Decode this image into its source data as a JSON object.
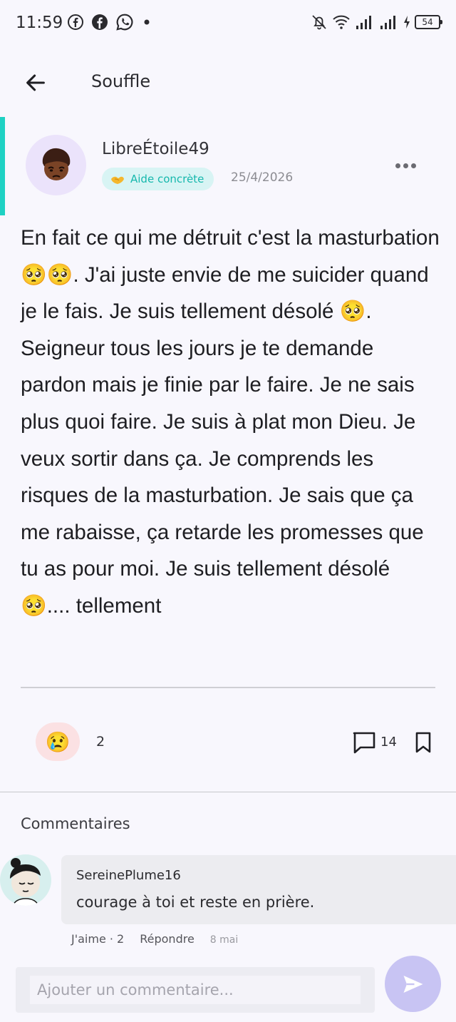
{
  "status_bar": {
    "time": "11:59",
    "battery": "54"
  },
  "app_bar": {
    "title": "Souffle"
  },
  "post": {
    "author": "LibreÉtoile49",
    "tag_label": "Aide concrète",
    "date": "25/4/2026",
    "body": "En fait ce qui me détruit c'est la masturbation 🥺🥺. J'ai juste envie de me suicider quand je le fais.  Je suis tellement désolé 🥺. Seigneur tous les jours je te demande pardon mais je finie par le faire.  Je ne sais plus quoi faire. Je suis à plat mon Dieu.  Je veux sortir dans ça. Je comprends les risques de la masturbation.  Je sais que ça me rabaisse, ça retarde les promesses que tu as pour moi.  Je suis tellement désolé 🥺.... tellement",
    "reaction_emoji": "😢",
    "reaction_count": "2",
    "comment_count": "14"
  },
  "comments_section": {
    "heading": "Commentaires",
    "items": [
      {
        "author": "SereinePlume16",
        "text": "courage à toi et reste en prière.",
        "like_label": "J'aime · 2",
        "reply_label": "Répondre",
        "date": "8 mai"
      }
    ]
  },
  "composer": {
    "placeholder": "Ajouter un commentaire..."
  },
  "colors": {
    "accent_teal": "#1fd1c3",
    "send_button": "#c8c4f3",
    "reaction_bg": "#fbe1e3",
    "tag_bg": "#d8f4f4"
  }
}
